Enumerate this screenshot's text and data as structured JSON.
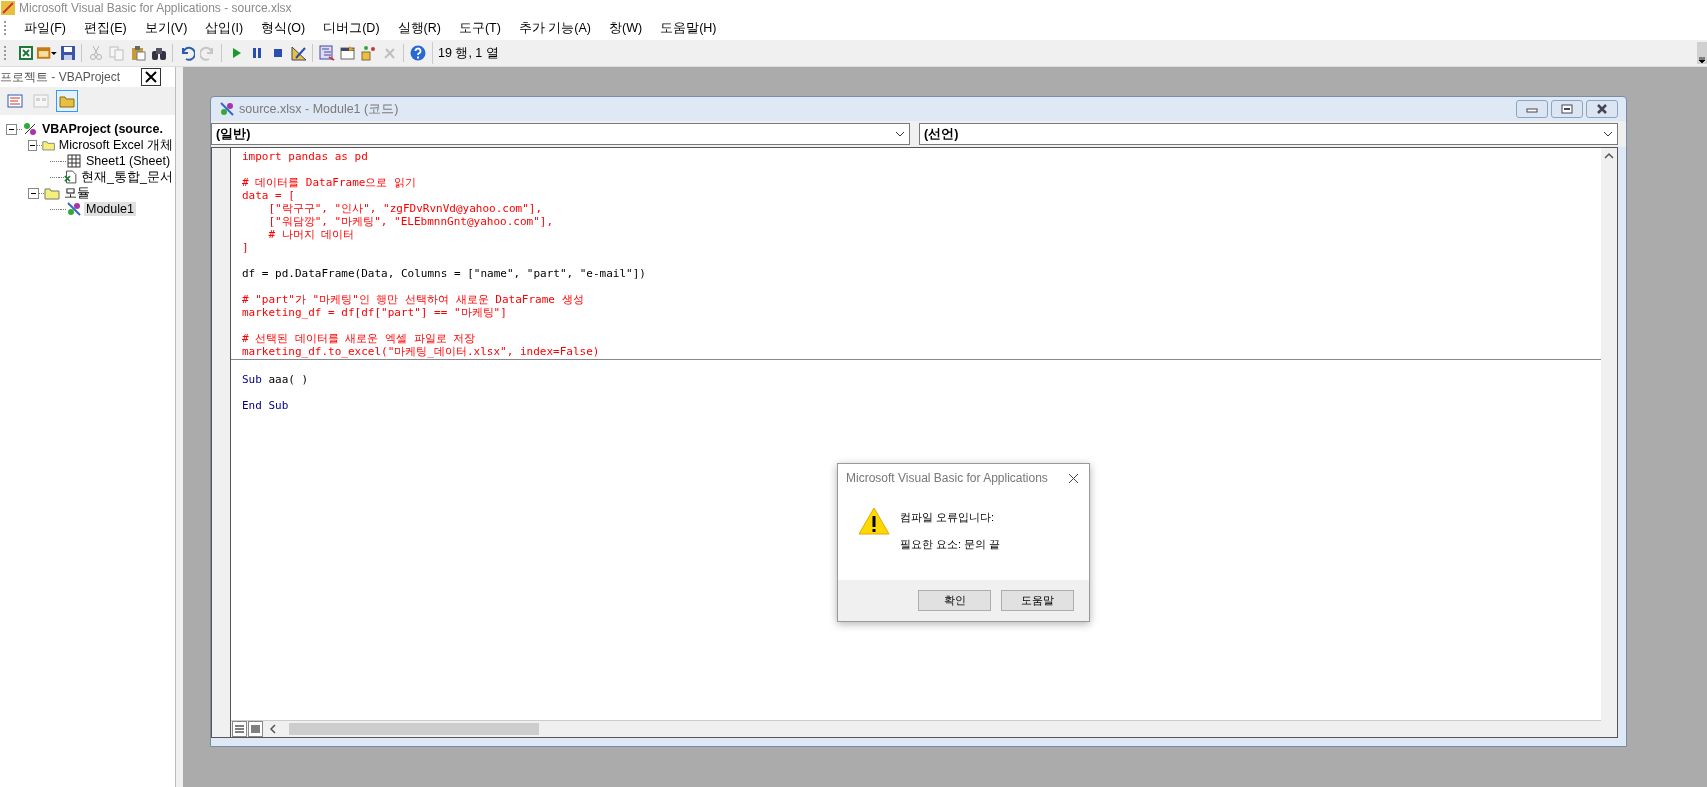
{
  "window": {
    "title": "Microsoft Visual Basic for Applications - source.xlsx"
  },
  "menu": [
    {
      "label": "파일(F)"
    },
    {
      "label": "편집(E)"
    },
    {
      "label": "보기(V)"
    },
    {
      "label": "삽입(I)"
    },
    {
      "label": "형식(O)"
    },
    {
      "label": "디버그(D)"
    },
    {
      "label": "실행(R)"
    },
    {
      "label": "도구(T)"
    },
    {
      "label": "추가 기능(A)"
    },
    {
      "label": "창(W)"
    },
    {
      "label": "도움말(H)"
    }
  ],
  "toolbar": {
    "buttons": [
      {
        "kind": "excel",
        "disabled": false
      },
      {
        "kind": "form",
        "disabled": false
      },
      {
        "kind": "save",
        "disabled": false
      },
      {
        "kind": "sep"
      },
      {
        "kind": "cut",
        "disabled": true
      },
      {
        "kind": "copy",
        "disabled": true
      },
      {
        "kind": "paste",
        "disabled": false
      },
      {
        "kind": "find",
        "disabled": false
      },
      {
        "kind": "sep"
      },
      {
        "kind": "undo",
        "disabled": false
      },
      {
        "kind": "redo",
        "disabled": true
      },
      {
        "kind": "sep"
      },
      {
        "kind": "run",
        "disabled": false
      },
      {
        "kind": "pause",
        "disabled": false
      },
      {
        "kind": "stop",
        "disabled": false
      },
      {
        "kind": "design",
        "disabled": false
      },
      {
        "kind": "sep"
      },
      {
        "kind": "explorer",
        "disabled": false
      },
      {
        "kind": "properties",
        "disabled": false
      },
      {
        "kind": "browser",
        "disabled": false
      },
      {
        "kind": "toolbox",
        "disabled": true
      },
      {
        "kind": "sep"
      },
      {
        "kind": "help",
        "disabled": false
      }
    ],
    "position": "19 행, 1 열"
  },
  "project": {
    "title": "프로젝트 - VBAProject",
    "buttons": [
      {
        "kind": "code",
        "disabled": false,
        "pressed": false
      },
      {
        "kind": "object",
        "disabled": true,
        "pressed": false
      },
      {
        "kind": "folders",
        "disabled": false,
        "pressed": true
      }
    ],
    "tree": [
      {
        "label": "VBAProject (source.",
        "kind": "project",
        "selected": false,
        "expanded": true,
        "children": [
          {
            "label": "Microsoft Excel 개체",
            "kind": "folder",
            "selected": false,
            "expanded": true,
            "children": [
              {
                "label": "Sheet1 (Sheet)",
                "kind": "sheet",
                "selected": false
              },
              {
                "label": "현재_통합_문서",
                "kind": "workbook",
                "selected": false
              }
            ]
          },
          {
            "label": "모듈",
            "kind": "folder",
            "selected": false,
            "expanded": true,
            "children": [
              {
                "label": "Module1",
                "kind": "module",
                "selected": true
              }
            ]
          }
        ]
      }
    ]
  },
  "code_window": {
    "title": "source.xlsx - Module1 (코드)",
    "object_box": "(일반)",
    "procedure_box": "(선언)",
    "sections": [
      {
        "blocks": [
          {
            "lines": [
              {
                "segments": [
                  {
                    "text": "import pandas as pd",
                    "kind": "error"
                  }
                ]
              }
            ]
          },
          {
            "lines": [
              {
                "segments": [
                  {
                    "text": "# 데이터를 DataFrame으로 읽기",
                    "kind": "error"
                  }
                ]
              },
              {
                "segments": [
                  {
                    "text": "data = [",
                    "kind": "error"
                  }
                ]
              },
              {
                "segments": [
                  {
                    "text": "    [\"락구구\", \"인사\", \"zgFDvRvnVd@yahoo.com\"],",
                    "kind": "error"
                  }
                ]
              },
              {
                "segments": [
                  {
                    "text": "    [\"워담깡\", \"마케팅\", \"ELEbmnnGnt@yahoo.com\"],",
                    "kind": "error"
                  }
                ]
              },
              {
                "segments": [
                  {
                    "text": "    # 나머지 데이터",
                    "kind": "error"
                  }
                ]
              },
              {
                "segments": [
                  {
                    "text": "]",
                    "kind": "error"
                  }
                ]
              }
            ]
          },
          {
            "lines": [
              {
                "segments": [
                  {
                    "text": "df = pd.DataFrame(Data, Columns = [\"name\", \"part\", \"e-mail\"])",
                    "kind": "plain"
                  }
                ]
              }
            ]
          },
          {
            "lines": [
              {
                "segments": [
                  {
                    "text": "# \"part\"가 \"마케팅\"인 행만 선택하여 새로운 DataFrame 생성",
                    "kind": "error"
                  }
                ]
              },
              {
                "segments": [
                  {
                    "text": "marketing_df = df[df[\"part\"] == \"마케팅\"]",
                    "kind": "error"
                  }
                ]
              }
            ]
          },
          {
            "lines": [
              {
                "segments": [
                  {
                    "text": "# 선택된 데이터를 새로운 엑셀 파일로 저장",
                    "kind": "error"
                  }
                ]
              },
              {
                "segments": [
                  {
                    "text": "marketing_df.to_excel(\"마케팅_데이터.xlsx\", index=False)",
                    "kind": "error"
                  }
                ]
              }
            ]
          }
        ]
      },
      {
        "blocks": [
          {
            "lines": [
              {
                "segments": [
                  {
                    "text": "Sub",
                    "kind": "keyword"
                  },
                  {
                    "text": " aaa( )",
                    "kind": "plain"
                  }
                ]
              }
            ]
          },
          {
            "lines": [
              {
                "segments": [
                  {
                    "text": "End Sub",
                    "kind": "keyword"
                  }
                ]
              }
            ]
          }
        ]
      }
    ]
  },
  "dialog": {
    "title": "Microsoft Visual Basic for Applications",
    "messages": [
      "컴파일 오류입니다:",
      "필요한 요소: 문의 끝"
    ],
    "buttons": [
      "확인",
      "도움말"
    ]
  }
}
